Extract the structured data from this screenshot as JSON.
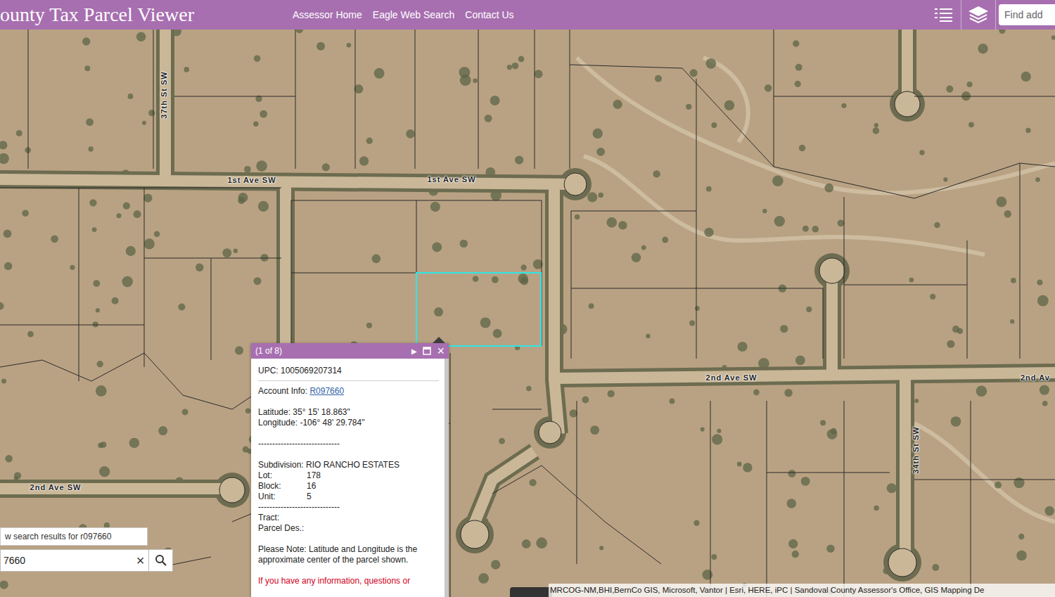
{
  "header": {
    "title": "ounty Tax Parcel Viewer",
    "nav": [
      "Assessor Home",
      "Eagle Web Search",
      "Contact Us"
    ],
    "search": {
      "placeholder": "Find add"
    }
  },
  "map": {
    "road_labels": [
      "37th St SW",
      "1st Ave SW",
      "1st Ave SW",
      "2nd Ave SW",
      "2nd Av",
      "2nd Ave SW",
      "34th St SW"
    ],
    "attribution": "MRCOG-NM,BHI,BernCo GIS, Microsoft, Vantor | Esri, HERE, iPC | Sandoval County Assessor's Office, GIS Mapping De"
  },
  "popup": {
    "counter": "(1 of 8)",
    "next": "▶",
    "close": "×",
    "upc": "UPC: 1005069207314",
    "account_label": "Account Info:",
    "account_link": "R097660",
    "latitude": "Latitude: 35° 15' 18.863\"",
    "longitude": "Longitude: -106° 48' 29.784\"",
    "divider": "-----------------------------",
    "subdivision": "Subdivision: RIO RANCHO ESTATES",
    "attributes": [
      {
        "label": "Lot:",
        "value": "178"
      },
      {
        "label": "Block:",
        "value": "16"
      },
      {
        "label": "Unit:",
        "value": "5"
      }
    ],
    "tract": "Tract:",
    "parcel_des": "Parcel Des.:",
    "note": "Please Note: Latitude and Longitude is the approximate center of the parcel shown.",
    "contact": "If you have any information, questions or"
  },
  "search_widget": {
    "results_link": "w search results for r097660",
    "value": "7660",
    "clear": "×"
  }
}
